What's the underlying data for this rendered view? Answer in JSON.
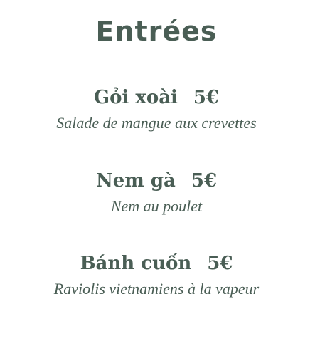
{
  "menu": {
    "title": "Entrées",
    "items": [
      {
        "name": "Gỏi xoài",
        "price": "5€",
        "description": "Salade de mangue aux crevettes"
      },
      {
        "name": "Nem gà",
        "price": "5€",
        "description": "Nem au poulet"
      },
      {
        "name": "Bánh cuốn",
        "price": "5€",
        "description": "Raviolis vietnamiens à la vapeur"
      }
    ]
  },
  "colors": {
    "text": "#4a5e55",
    "background": "#ffffff"
  }
}
